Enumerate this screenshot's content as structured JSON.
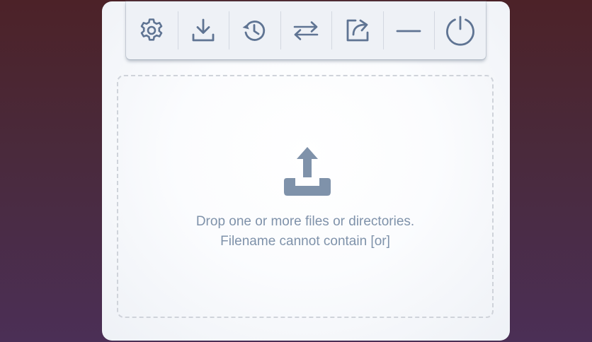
{
  "toolbar": {
    "buttons": [
      {
        "icon": "gear-icon",
        "title": "Settings"
      },
      {
        "icon": "download-icon",
        "title": "Download"
      },
      {
        "icon": "history-icon",
        "title": "History"
      },
      {
        "icon": "swap-icon",
        "title": "Transfer"
      },
      {
        "icon": "share-icon",
        "title": "Share"
      },
      {
        "icon": "minimize-icon",
        "title": "Minimize"
      },
      {
        "icon": "power-icon",
        "title": "Power"
      }
    ],
    "icon_color": "#5f7493"
  },
  "drop_zone": {
    "icon": "upload-icon",
    "line1": "Drop one or more files or directories.",
    "line2": "Filename cannot contain [or]",
    "text_color": "#7f92aa"
  }
}
